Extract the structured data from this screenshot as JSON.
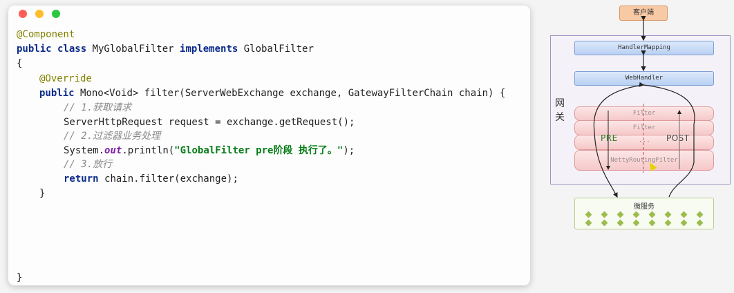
{
  "code": {
    "l1": "@Component",
    "l2_kw1": "public class ",
    "l2_txt1": "MyGlobalFilter ",
    "l2_kw2": "implements ",
    "l2_txt2": "GlobalFilter",
    "l3": "{",
    "l4": "@Override",
    "l5_kw": "public ",
    "l5_txt": "Mono<Void> filter(ServerWebExchange exchange, GatewayFilterChain chain) {",
    "l6": "// 1.获取请求",
    "l7": "ServerHttpRequest request = exchange.getRequest();",
    "l8": "// 2.过滤器业务处理",
    "l9_a": "System.",
    "l9_b": "out",
    "l9_c": ".println(",
    "l9_str": "\"GlobalFilter pre阶段 执行了。\"",
    "l9_d": ");",
    "l10": "// 3.放行",
    "l11_kw": "return ",
    "l11_txt": "chain.filter(exchange);",
    "l12": "}",
    "l13": "}"
  },
  "diagram": {
    "client": "客户端",
    "gateway": "网关",
    "handler_mapping": "HandlerMapping",
    "web_handler": "WebHandler",
    "filter1": "Filter",
    "filter2": "Filter",
    "pre": "PRE",
    "post": "POST",
    "ellipsis": ". . .",
    "netty": "NettyRoutingFilter",
    "microservice": "微服务"
  },
  "colors": {
    "keyword": "#0b2a8a",
    "annotation": "#808000",
    "comment": "#8a8a8a",
    "string": "#067d17",
    "pre": "#2e7a24"
  }
}
